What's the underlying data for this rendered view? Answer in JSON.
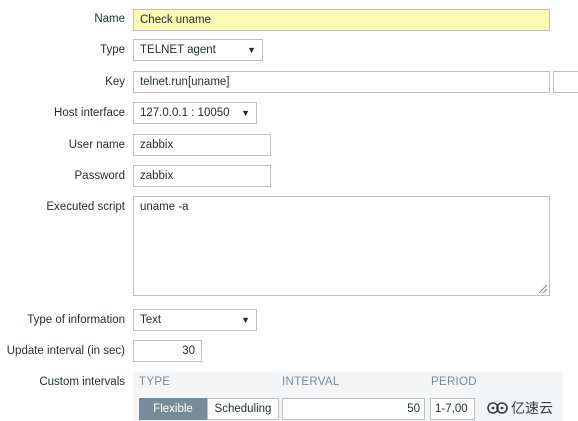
{
  "form": {
    "name": {
      "label": "Name",
      "value": "Check uname"
    },
    "type": {
      "label": "Type",
      "value": "TELNET agent"
    },
    "key": {
      "label": "Key",
      "value": "telnet.run[uname]"
    },
    "host_interface": {
      "label": "Host interface",
      "value": "127.0.0.1 : 10050"
    },
    "user_name": {
      "label": "User name",
      "value": "zabbix"
    },
    "password": {
      "label": "Password",
      "value": "zabbix"
    },
    "executed_script": {
      "label": "Executed script",
      "value": "uname -a"
    },
    "type_of_information": {
      "label": "Type of information",
      "value": "Text"
    },
    "update_interval": {
      "label": "Update interval (in sec)",
      "value": "30"
    },
    "custom_intervals": {
      "label": "Custom intervals",
      "columns": [
        "TYPE",
        "INTERVAL",
        "PERIOD"
      ],
      "type_options": [
        "Flexible",
        "Scheduling"
      ],
      "selected_type": "Flexible",
      "interval_value": "50",
      "period_value": "1-7,00"
    }
  },
  "watermark": {
    "text": "亿速云"
  },
  "icons": {
    "dropdown": "dropdown-arrow-icon",
    "resize": "resize-grip-icon",
    "watermark": "yisu-logo-icon"
  }
}
